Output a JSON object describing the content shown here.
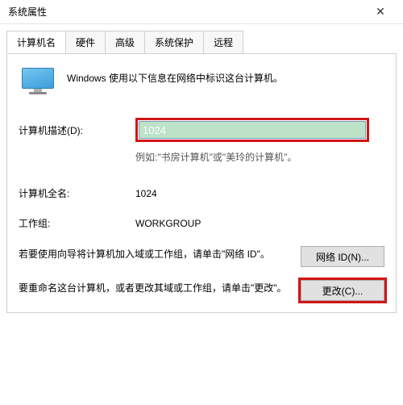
{
  "window": {
    "title": "系统属性",
    "close_glyph": "✕"
  },
  "tabs": {
    "computer_name": "计算机名",
    "hardware": "硬件",
    "advanced": "高级",
    "system_protection": "系统保护",
    "remote": "远程"
  },
  "intro": {
    "text": "Windows 使用以下信息在网络中标识这台计算机。"
  },
  "description": {
    "label": "计算机描述(D):",
    "value": "1024",
    "example": "例如:\"书房计算机\"或\"美玲的计算机\"。"
  },
  "full_name": {
    "label": "计算机全名:",
    "value": "1024"
  },
  "workgroup": {
    "label": "工作组:",
    "value": "WORKGROUP"
  },
  "network_id": {
    "text": "若要使用向导将计算机加入域或工作组，请单击\"网络 ID\"。",
    "button": "网络 ID(N)..."
  },
  "change": {
    "text": "要重命名这台计算机，或者更改其域或工作组，请单击\"更改\"。",
    "button": "更改(C)..."
  }
}
